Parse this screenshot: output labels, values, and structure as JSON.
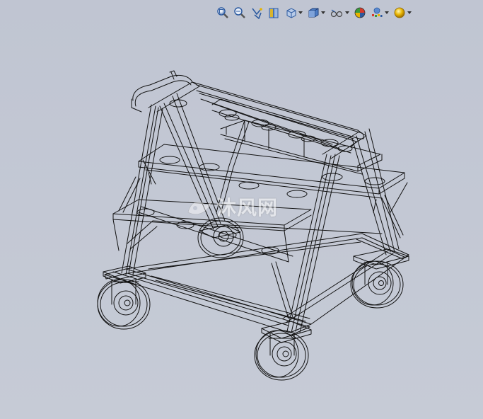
{
  "toolbar": {
    "icons": [
      "zoom-to-fit-icon",
      "zoom-to-area-icon",
      "previous-view-icon",
      "section-view-icon",
      "view-orientation-icon",
      "display-style-icon",
      "hide-show-items-icon",
      "edit-appearance-icon",
      "apply-scene-icon",
      "view-settings-icon"
    ]
  },
  "watermark": {
    "text": "沐风网"
  },
  "colors": {
    "background": "#c3c8d4",
    "wireframe": "#111111",
    "toolbar_icon_blue": "#2c5aa0",
    "toolbar_icon_yellow": "#e8b400"
  }
}
